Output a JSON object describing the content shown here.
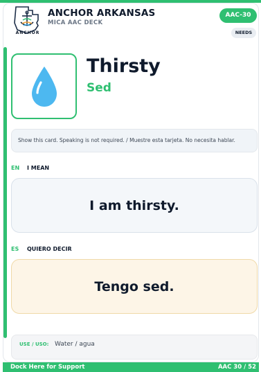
{
  "header": {
    "logo_text": "ANCHOR",
    "org": "ANCHOR ARKANSAS",
    "deck": "MICA AAC DECK",
    "code": "AAC-30",
    "category": "NEEDS",
    "logo_icon": "anchor-arkansas-logo-icon"
  },
  "card": {
    "picture_icon": "water-drop-icon",
    "title_en": "Thirsty",
    "title_es": "Sed",
    "instruction": "Show this card. Speaking is not required. / Muestre esta tarjeta. No necesita hablar."
  },
  "english": {
    "code": "EN",
    "label": "I MEAN",
    "phrase": "I am thirsty."
  },
  "spanish": {
    "code": "ES",
    "label": "QUIERO DECIR",
    "phrase": "Tengo sed."
  },
  "use": {
    "label": "USE / USO:",
    "text": "Water / agua"
  },
  "footer": {
    "left": "Dock Here for Support",
    "right": "AAC 30 / 52"
  },
  "colors": {
    "accent": "#2fbf71",
    "ink": "#0f1a2c",
    "drop": "#4db8f0"
  }
}
